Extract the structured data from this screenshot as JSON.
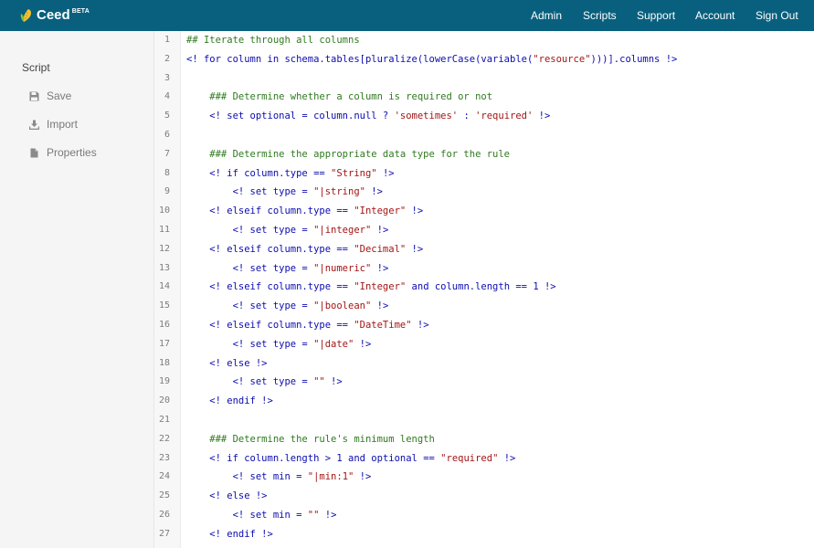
{
  "navbar": {
    "brand": {
      "name": "Ceed",
      "badge": "BETA"
    },
    "links": [
      {
        "id": "admin",
        "label": "Admin"
      },
      {
        "id": "scripts",
        "label": "Scripts"
      },
      {
        "id": "support",
        "label": "Support"
      },
      {
        "id": "account",
        "label": "Account"
      },
      {
        "id": "signout",
        "label": "Sign Out"
      }
    ],
    "color": "#08607e"
  },
  "sidebar": {
    "heading": "Script",
    "items": [
      {
        "id": "save",
        "label": "Save",
        "icon": "floppy-disk-icon"
      },
      {
        "id": "import",
        "label": "Import",
        "icon": "download-icon"
      },
      {
        "id": "properties",
        "label": "Properties",
        "icon": "document-icon"
      }
    ]
  },
  "editor": {
    "lines": [
      {
        "n": "1",
        "parts": [
          {
            "t": "## Iterate through all columns",
            "c": "cm"
          }
        ]
      },
      {
        "n": "2",
        "parts": [
          {
            "t": "<! for column in schema.tables[pluralize(lowerCase(variable(",
            "c": "kw"
          },
          {
            "t": "\"resource\"",
            "c": "str"
          },
          {
            "t": ")))].columns !>",
            "c": "kw"
          }
        ]
      },
      {
        "n": "3",
        "parts": []
      },
      {
        "n": "4",
        "parts": [
          {
            "t": "    ### Determine whether a column is required or not",
            "c": "cm"
          }
        ]
      },
      {
        "n": "5",
        "parts": [
          {
            "t": "    <! set optional = column.null ? ",
            "c": "kw"
          },
          {
            "t": "'sometimes'",
            "c": "str"
          },
          {
            "t": " : ",
            "c": "kw"
          },
          {
            "t": "'required'",
            "c": "str"
          },
          {
            "t": " !>",
            "c": "kw"
          }
        ]
      },
      {
        "n": "6",
        "parts": []
      },
      {
        "n": "7",
        "parts": [
          {
            "t": "    ### Determine the appropriate data type for the rule",
            "c": "cm"
          }
        ]
      },
      {
        "n": "8",
        "parts": [
          {
            "t": "    <! if column.type == ",
            "c": "kw"
          },
          {
            "t": "\"String\"",
            "c": "str"
          },
          {
            "t": " !>",
            "c": "kw"
          }
        ]
      },
      {
        "n": "9",
        "parts": [
          {
            "t": "        <! set type = ",
            "c": "kw"
          },
          {
            "t": "\"|string\"",
            "c": "str"
          },
          {
            "t": " !>",
            "c": "kw"
          }
        ]
      },
      {
        "n": "10",
        "parts": [
          {
            "t": "    <! elseif column.type == ",
            "c": "kw"
          },
          {
            "t": "\"Integer\"",
            "c": "str"
          },
          {
            "t": " !>",
            "c": "kw"
          }
        ]
      },
      {
        "n": "11",
        "parts": [
          {
            "t": "        <! set type = ",
            "c": "kw"
          },
          {
            "t": "\"|integer\"",
            "c": "str"
          },
          {
            "t": " !>",
            "c": "kw"
          }
        ]
      },
      {
        "n": "12",
        "parts": [
          {
            "t": "    <! elseif column.type == ",
            "c": "kw"
          },
          {
            "t": "\"Decimal\"",
            "c": "str"
          },
          {
            "t": " !>",
            "c": "kw"
          }
        ]
      },
      {
        "n": "13",
        "parts": [
          {
            "t": "        <! set type = ",
            "c": "kw"
          },
          {
            "t": "\"|numeric\"",
            "c": "str"
          },
          {
            "t": " !>",
            "c": "kw"
          }
        ]
      },
      {
        "n": "14",
        "parts": [
          {
            "t": "    <! elseif column.type == ",
            "c": "kw"
          },
          {
            "t": "\"Integer\"",
            "c": "str"
          },
          {
            "t": " and column.length == ",
            "c": "kw"
          },
          {
            "t": "1",
            "c": "num"
          },
          {
            "t": " !>",
            "c": "kw"
          }
        ]
      },
      {
        "n": "15",
        "parts": [
          {
            "t": "        <! set type = ",
            "c": "kw"
          },
          {
            "t": "\"|boolean\"",
            "c": "str"
          },
          {
            "t": " !>",
            "c": "kw"
          }
        ]
      },
      {
        "n": "16",
        "parts": [
          {
            "t": "    <! elseif column.type == ",
            "c": "kw"
          },
          {
            "t": "\"DateTime\"",
            "c": "str"
          },
          {
            "t": " !>",
            "c": "kw"
          }
        ]
      },
      {
        "n": "17",
        "parts": [
          {
            "t": "        <! set type = ",
            "c": "kw"
          },
          {
            "t": "\"|date\"",
            "c": "str"
          },
          {
            "t": " !>",
            "c": "kw"
          }
        ]
      },
      {
        "n": "18",
        "parts": [
          {
            "t": "    <! else !>",
            "c": "kw"
          }
        ]
      },
      {
        "n": "19",
        "parts": [
          {
            "t": "        <! set type = ",
            "c": "kw"
          },
          {
            "t": "\"\"",
            "c": "str"
          },
          {
            "t": " !>",
            "c": "kw"
          }
        ]
      },
      {
        "n": "20",
        "parts": [
          {
            "t": "    <! endif !>",
            "c": "kw"
          }
        ]
      },
      {
        "n": "21",
        "parts": []
      },
      {
        "n": "22",
        "parts": [
          {
            "t": "    ### Determine the rule's minimum length",
            "c": "cm"
          }
        ]
      },
      {
        "n": "23",
        "parts": [
          {
            "t": "    <! if column.length > ",
            "c": "kw"
          },
          {
            "t": "1",
            "c": "num"
          },
          {
            "t": " and optional == ",
            "c": "kw"
          },
          {
            "t": "\"required\"",
            "c": "str"
          },
          {
            "t": " !>",
            "c": "kw"
          }
        ]
      },
      {
        "n": "24",
        "parts": [
          {
            "t": "        <! set min = ",
            "c": "kw"
          },
          {
            "t": "\"|min:1\"",
            "c": "str"
          },
          {
            "t": " !>",
            "c": "kw"
          }
        ]
      },
      {
        "n": "25",
        "parts": [
          {
            "t": "    <! else !>",
            "c": "kw"
          }
        ]
      },
      {
        "n": "26",
        "parts": [
          {
            "t": "        <! set min = ",
            "c": "kw"
          },
          {
            "t": "\"\"",
            "c": "str"
          },
          {
            "t": " !>",
            "c": "kw"
          }
        ]
      },
      {
        "n": "27",
        "parts": [
          {
            "t": "    <! endif !>",
            "c": "kw"
          }
        ]
      }
    ]
  }
}
